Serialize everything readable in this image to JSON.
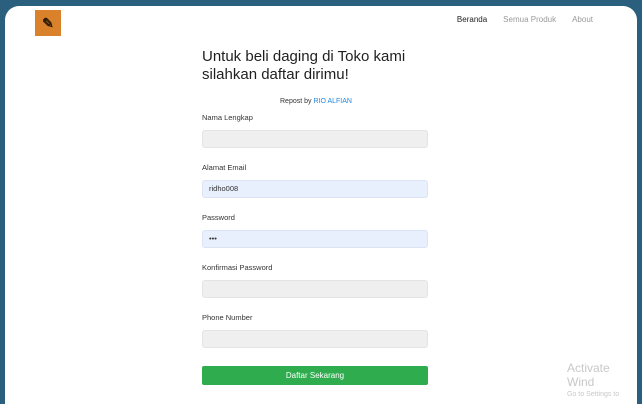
{
  "nav": {
    "logo_icon": "knife-logo-icon",
    "items": [
      {
        "label": "Beranda",
        "state": "active"
      },
      {
        "label": "Semua Produk",
        "state": "muted"
      },
      {
        "label": "About",
        "state": "muted"
      }
    ]
  },
  "form": {
    "title": "Untuk beli daging di Toko kami silahkan daftar dirimu!",
    "repost_prefix": "Repost by ",
    "repost_name": "RIO ALFIAN",
    "fields": {
      "nama": {
        "label": "Nama Lengkap",
        "value": ""
      },
      "email": {
        "label": "Alamat Email",
        "value": "ridho008"
      },
      "password": {
        "label": "Password",
        "value": "•••"
      },
      "konfirmasi": {
        "label": "Konfirmasi Password",
        "value": ""
      },
      "phone": {
        "label": "Phone Number",
        "value": ""
      }
    },
    "submit_label": "Daftar Sekarang"
  },
  "watermark": {
    "line1": "Activate Wind",
    "line2": "Go to Settings to"
  },
  "colors": {
    "outer_bg": "#2b5f7e",
    "logo_bg": "#d9822b",
    "link": "#1e88e5",
    "button": "#2eac4e"
  }
}
